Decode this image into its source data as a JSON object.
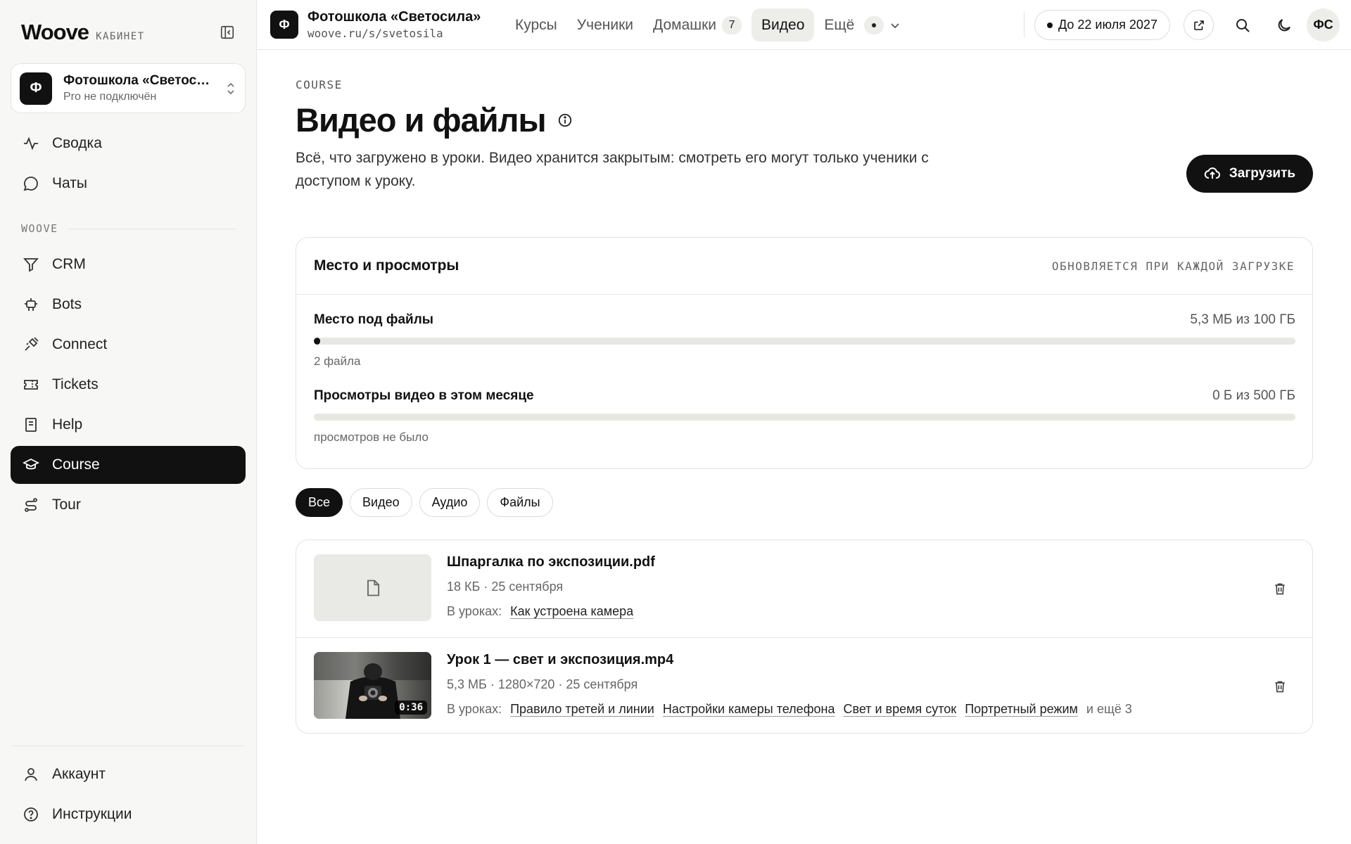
{
  "sidebar": {
    "brand": "Woove",
    "brand_sub": "КАБИНЕТ",
    "school": {
      "avatar": "Ф",
      "name": "Фотошкола «Светосила»",
      "plan": "Pro не подключён"
    },
    "top_items": [
      {
        "label": "Сводка",
        "icon": "activity-icon"
      },
      {
        "label": "Чаты",
        "icon": "chat-icon"
      }
    ],
    "section_label": "WOOVE",
    "items": [
      {
        "label": "CRM",
        "icon": "funnel-icon"
      },
      {
        "label": "Bots",
        "icon": "bot-icon"
      },
      {
        "label": "Connect",
        "icon": "plug-icon"
      },
      {
        "label": "Tickets",
        "icon": "ticket-icon"
      },
      {
        "label": "Help",
        "icon": "book-icon"
      },
      {
        "label": "Course",
        "icon": "graduation-cap-icon",
        "active": true
      },
      {
        "label": "Tour",
        "icon": "route-icon"
      }
    ],
    "bottom_items": [
      {
        "label": "Аккаунт",
        "icon": "user-icon"
      },
      {
        "label": "Инструкции",
        "icon": "help-circle-icon"
      }
    ]
  },
  "topbar": {
    "avatar": "Ф",
    "school_name": "Фотошкола «Светосила»",
    "school_url": "woove.ru/s/svetosila",
    "tabs": [
      {
        "label": "Курсы"
      },
      {
        "label": "Ученики"
      },
      {
        "label": "Домашки",
        "badge": "7"
      },
      {
        "label": "Видео",
        "active": true
      },
      {
        "label": "Ещё"
      }
    ],
    "plan_label": "До 22 июля 2027",
    "user_initials": "ФС"
  },
  "page": {
    "eyebrow": "COURSE",
    "title": "Видео и файлы",
    "description": "Всё, что загружено в уроки. Видео хранится закрытым: смотреть его могут только ученики с доступом к уроку.",
    "upload_label": "Загрузить"
  },
  "usage": {
    "title": "Место и просмотры",
    "note": "ОБНОВЛЯЕТСЯ ПРИ КАЖДОЙ ЗАГРУЗКЕ",
    "storage": {
      "label": "Место под файлы",
      "amount": "5,3 МБ из 100 ГБ",
      "fraction": 5e-05,
      "sub": "2 файла"
    },
    "views": {
      "label": "Просмотры видео в этом месяце",
      "amount": "0 Б из 500 ГБ",
      "fraction": 0,
      "sub": "просмотров не было"
    }
  },
  "filters": [
    {
      "label": "Все",
      "active": true
    },
    {
      "label": "Видео"
    },
    {
      "label": "Аудио"
    },
    {
      "label": "Файлы"
    }
  ],
  "files": [
    {
      "type": "document",
      "name": "Шпаргалка по экспозиции.pdf",
      "meta": "18 КБ · 25 сентября",
      "lessons_label": "В уроках:",
      "lessons": [
        "Как устроена камера"
      ],
      "more": ""
    },
    {
      "type": "video",
      "name": "Урок 1 — свет и экспозиция.mp4",
      "meta": "5,3 МБ · 1280×720 · 25 сентября",
      "duration": "0:36",
      "lessons_label": "В уроках:",
      "lessons": [
        "Правило третей и линии",
        "Настройки камеры телефона",
        "Свет и время суток",
        "Портретный режим"
      ],
      "more": "и ещё 3"
    }
  ]
}
